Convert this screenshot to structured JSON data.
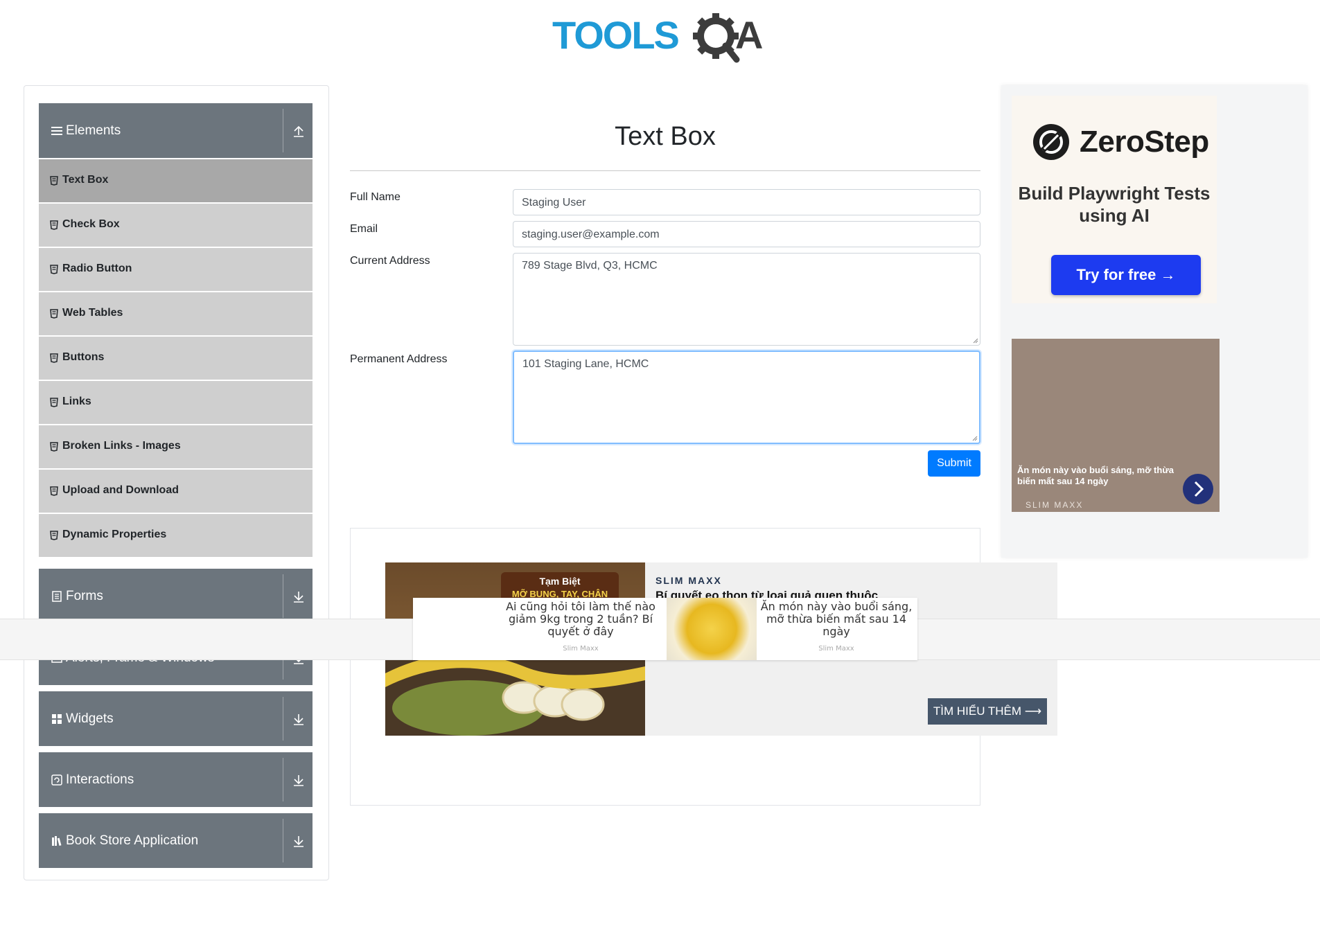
{
  "header": {
    "logo_text": "TOOLSQA"
  },
  "sidebar": {
    "groups": [
      {
        "label": "Elements",
        "icon": "menu-icon",
        "state": "expanded"
      },
      {
        "label": "Forms",
        "icon": "document-icon",
        "state": "collapsed"
      },
      {
        "label": "Alerts, Frame & Windows",
        "icon": "window-icon",
        "state": "collapsed"
      },
      {
        "label": "Widgets",
        "icon": "grid-icon",
        "state": "collapsed"
      },
      {
        "label": "Interactions",
        "icon": "interactions-icon",
        "state": "collapsed"
      },
      {
        "label": "Book Store Application",
        "icon": "books-icon",
        "state": "collapsed"
      }
    ],
    "items": [
      {
        "label": "Text Box",
        "active": true
      },
      {
        "label": "Check Box",
        "active": false
      },
      {
        "label": "Radio Button",
        "active": false
      },
      {
        "label": "Web Tables",
        "active": false
      },
      {
        "label": "Buttons",
        "active": false
      },
      {
        "label": "Links",
        "active": false
      },
      {
        "label": "Broken Links - Images",
        "active": false
      },
      {
        "label": "Upload and Download",
        "active": false
      },
      {
        "label": "Dynamic Properties",
        "active": false
      }
    ]
  },
  "main": {
    "title": "Text Box",
    "form": {
      "full_name": {
        "label": "Full Name",
        "value": "Staging User"
      },
      "email": {
        "label": "Email",
        "value": "staging.user@example.com"
      },
      "current_address": {
        "label": "Current Address",
        "value": "789 Stage Blvd, Q3, HCMC"
      },
      "permanent_address": {
        "label": "Permanent Address",
        "value": "101 Staging Lane, HCMC"
      },
      "submit_label": "Submit"
    }
  },
  "bottom_ad": {
    "img_caption_top": "Tạm Biệt",
    "img_caption_bottom": "MỠ BỤNG, TAY, CHÂN",
    "brand": "SLIM MAXX",
    "headline": "Bí quyết eo thon từ loại quả quen thuộc",
    "cta": "TÌM HIỂU THÊM ⟶"
  },
  "overlay_ad": {
    "left_text": "Ai cũng hỏi tôi làm thế nào giảm 9kg trong 2 tuần? Bí quyết ở đây",
    "left_source": "Slim Maxx",
    "right_text": "Ăn món này vào buổi sáng, mỡ thừa biến mất sau 14 ngày",
    "right_source": "Slim Maxx"
  },
  "right_ad": {
    "brand": "ZeroStep",
    "tagline": "Build Playwright Tests using AI",
    "cta": "Try for free →",
    "slim_text": "Ăn món này vào buổi sáng, mỡ thừa biến mất sau 14 ngày",
    "slim_brand": "SLIM MAXX"
  },
  "colors": {
    "sidebar_header": "#6c757d",
    "menu_item": "#cfcfcf",
    "menu_item_active": "#a8a8a8",
    "primary": "#007bff",
    "zerostep_button": "#1d3bf0",
    "logo_blue": "#1f9ad6",
    "logo_dark": "#3c3c3c"
  }
}
